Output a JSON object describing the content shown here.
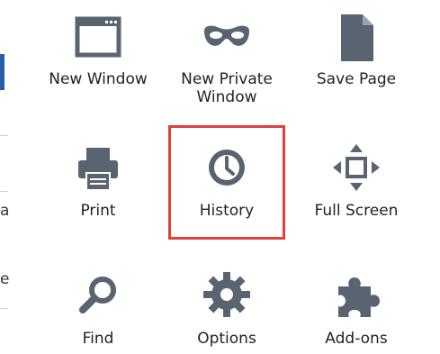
{
  "menu": {
    "items": [
      {
        "label": "New Window",
        "icon": "window-icon"
      },
      {
        "label": "New Private\nWindow",
        "icon": "mask-icon"
      },
      {
        "label": "Save Page",
        "icon": "page-icon"
      },
      {
        "label": "Print",
        "icon": "printer-icon"
      },
      {
        "label": "History",
        "icon": "clock-icon"
      },
      {
        "label": "Full Screen",
        "icon": "fullscreen-icon"
      },
      {
        "label": "Find",
        "icon": "magnifier-icon"
      },
      {
        "label": "Options",
        "icon": "gear-icon"
      },
      {
        "label": "Add-ons",
        "icon": "puzzle-icon"
      }
    ],
    "highlighted": "History"
  },
  "colors": {
    "icon": "#5a6470",
    "highlight": "#e0413a",
    "text": "#222222"
  },
  "edge": {
    "glyph_a": "a",
    "glyph_e": "e"
  }
}
